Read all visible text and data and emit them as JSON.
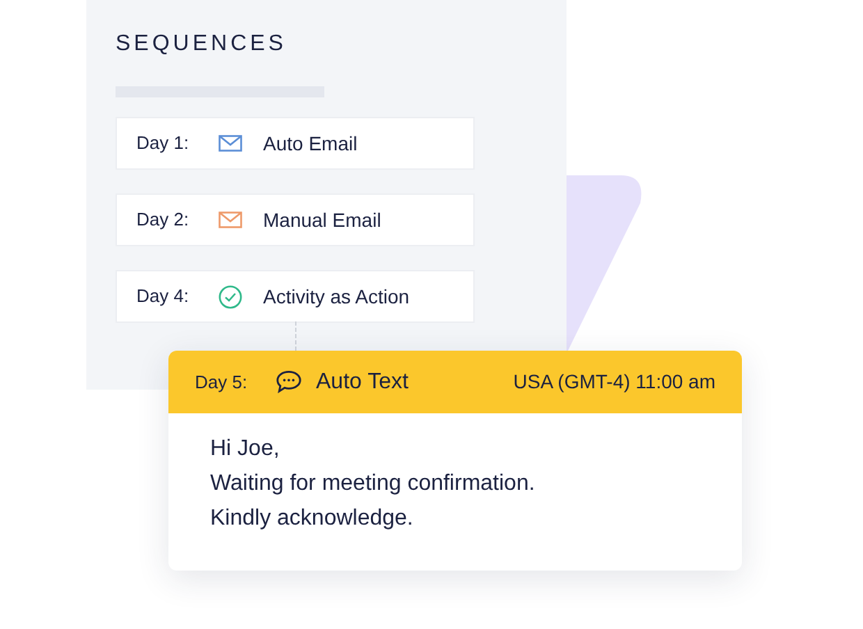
{
  "panel": {
    "title": "SEQUENCES"
  },
  "steps": [
    {
      "day": "Day 1:",
      "kind": "auto_email",
      "label": "Auto Email"
    },
    {
      "day": "Day 2:",
      "kind": "manual_email",
      "label": "Manual Email"
    },
    {
      "day": "Day 4:",
      "kind": "activity",
      "label": "Activity as Action"
    }
  ],
  "message_card": {
    "day": "Day 5:",
    "kind": "auto_text",
    "label": "Auto Text",
    "schedule": "USA (GMT-4) 11:00 am",
    "lines": [
      "Hi Joe,",
      "Waiting for meeting confirmation.",
      "Kindly acknowledge."
    ]
  }
}
